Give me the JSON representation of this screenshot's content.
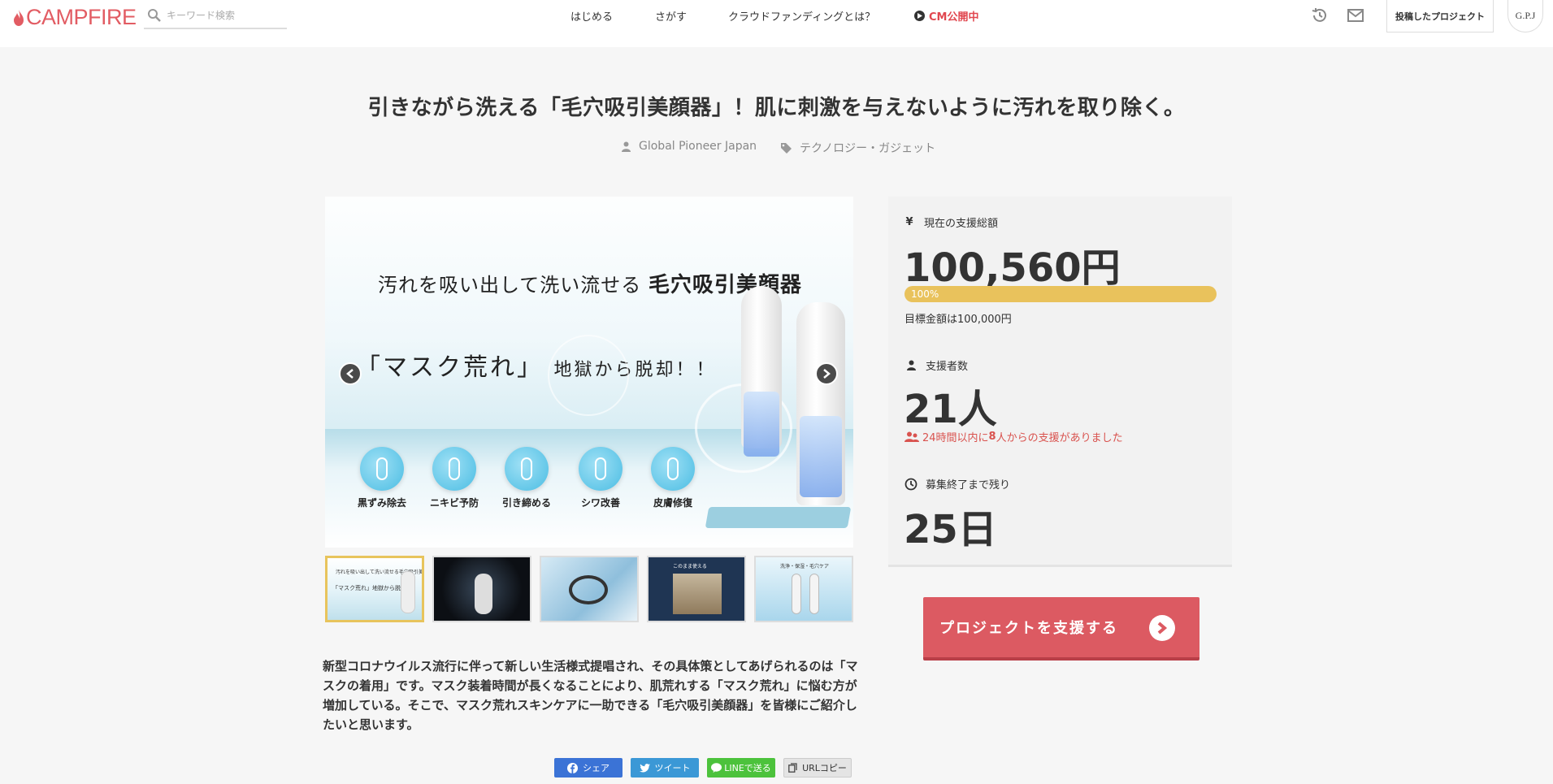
{
  "header": {
    "logo_text": "CAMPFIRE",
    "search_placeholder": "キーワード検索",
    "nav": {
      "start": "はじめる",
      "search": "さがす",
      "about": "クラウドファンディングとは？",
      "cm": "CM公開中"
    },
    "posted_projects": "投稿したプロジェクト",
    "avatar_text": "G.P.J"
  },
  "project": {
    "title": "引きながら洗える「毛穴吸引美顔器」！肌に刺激を与えないように汚れを取り除く。",
    "owner": "Global Pioneer Japan",
    "category": "テクノロジー・ガジェット"
  },
  "main_image": {
    "headline_small": "汚れを吸い出して洗い流せる",
    "headline_bold": "毛穴吸引美顔器",
    "subline_main": "「マスク荒れ」",
    "subline_small": "地獄から脱却！！",
    "features": [
      "黒ずみ除去",
      "ニキビ予防",
      "引き締める",
      "シワ改善",
      "皮膚修復"
    ]
  },
  "thumbnail_labels": {
    "t1": "汚れを吸い出して洗い流せる毛穴吸引美顔器",
    "t1b": "「マスク荒れ」地獄から脱却！！",
    "t4": "このまま使える",
    "t5": "洗浄・保湿・毛穴ケア"
  },
  "stats": {
    "amount_label": "現在の支援総額",
    "amount": "100,560円",
    "progress_text": "100%",
    "progress_percent": 100,
    "goal": "目標金額は100,000円",
    "backers_label": "支援者数",
    "backers": "21人",
    "recent_prefix": "24時間以内に",
    "recent_count": "8",
    "recent_suffix": "人からの支援がありました",
    "remaining_label": "募集終了まで残り",
    "remaining": "25日"
  },
  "support_button": "プロジェクトを支援する",
  "description": "新型コロナウイルス流行に伴って新しい生活様式提唱され、その具体策としてあげられるのは「マスクの着用」です。マスク装着時間が長くなることにより、肌荒れする「マスク荒れ」に悩む方が増加している。そこで、マスク荒れスキンケアに一助できる「毛穴吸引美顔器」を皆様にご紹介したいと思います。",
  "share": {
    "facebook": "シェア",
    "twitter": "ツイート",
    "line": "LINEで送る",
    "url": "URLコピー"
  },
  "colors": {
    "brand": "#e25c63",
    "support_button": "#dc5a62",
    "progress": "#e9c25c",
    "recent_text": "#d9534f"
  }
}
